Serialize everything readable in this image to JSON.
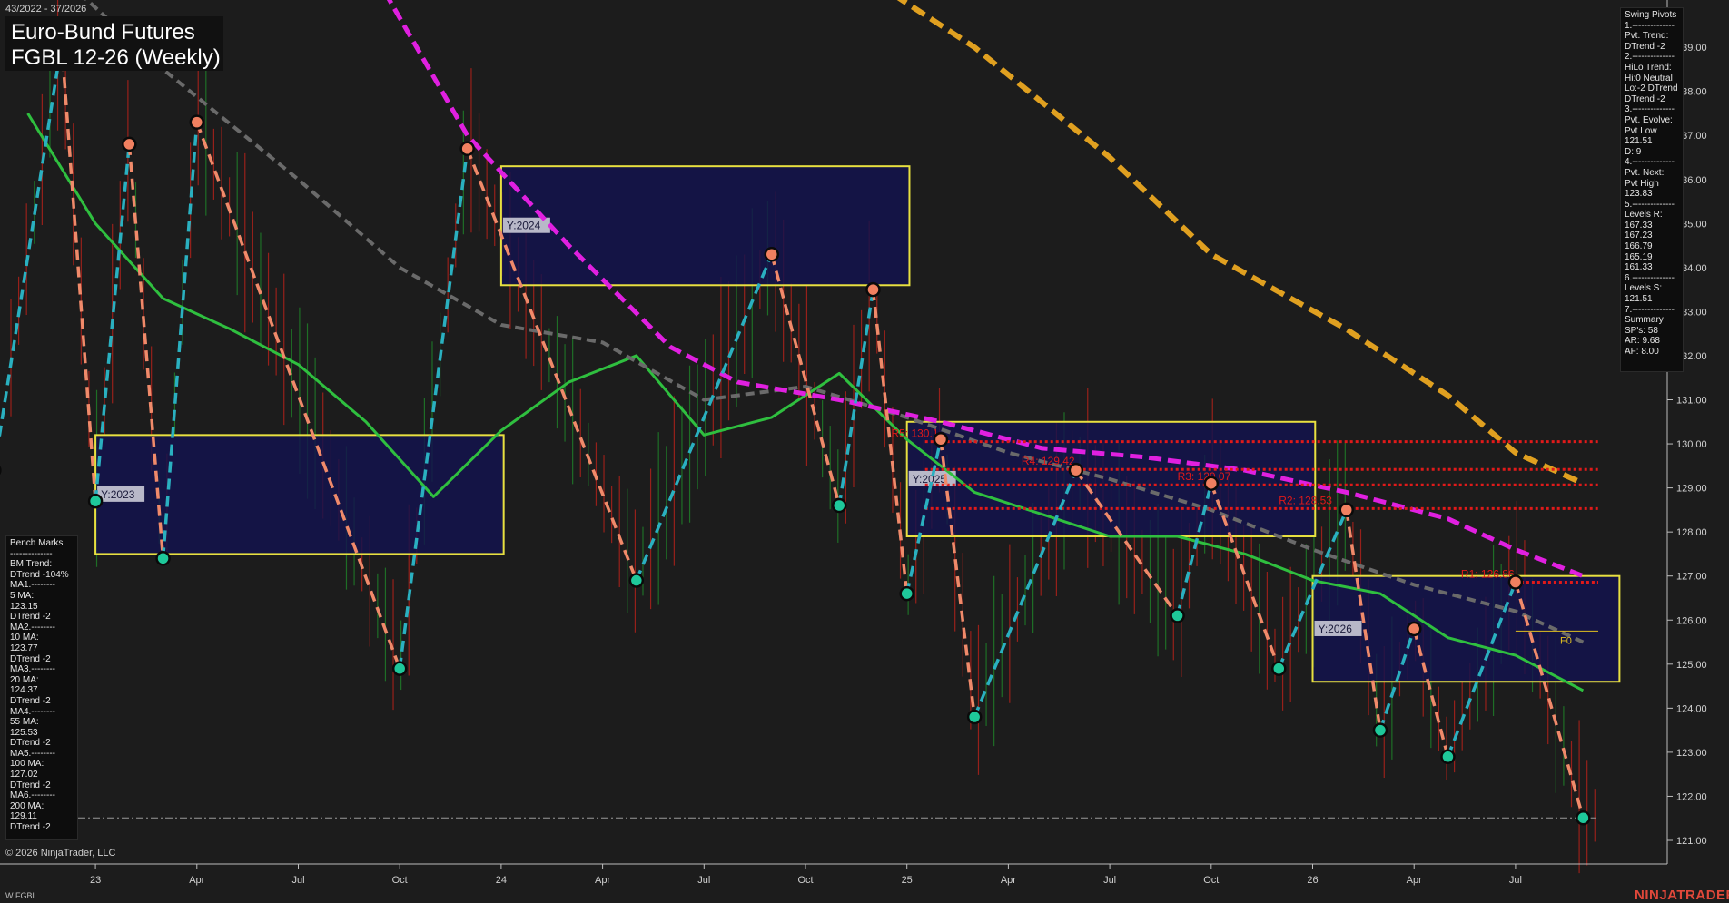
{
  "header": {
    "range": "43/2022 - 37/2026",
    "title_line1": "Euro-Bund Futures",
    "title_line2": "FGBL 12-26 (Weekly)"
  },
  "footer": {
    "copyright": "© 2026 NinjaTrader, LLC",
    "instrument": "W FGBL",
    "brand": "NINJATRADER"
  },
  "swing_panel": [
    "Swing Pivots",
    "1.--------------",
    "Pvt. Trend:",
    "DTrend -2",
    "2.--------------",
    "HiLo Trend:",
    "Hi:0 Neutral",
    "Lo:-2 DTrend",
    "DTrend -2",
    "3.--------------",
    "Pvt. Evolve:",
    "Pvt Low",
    "121.51",
    "D: 9",
    "4.--------------",
    "Pvt. Next:",
    "Pvt High",
    "123.83",
    "5.--------------",
    "Levels R:",
    "167.33",
    "167.23",
    "166.79",
    "165.19",
    "161.33",
    "6.--------------",
    "Levels S:",
    "121.51",
    "7.--------------",
    "Summary",
    "SP's: 58",
    "AR: 9.68",
    "AF: 8.00"
  ],
  "bench_panel": [
    "Bench Marks",
    "--------------",
    "BM Trend:",
    "DTrend -104%",
    "MA1.--------",
    "5 MA:",
    "123.15",
    "DTrend -2",
    "MA2.--------",
    "10 MA:",
    "123.77",
    "DTrend -2",
    "MA3.--------",
    "20 MA:",
    "124.37",
    "DTrend -2",
    "MA4.--------",
    "55 MA:",
    "125.53",
    "DTrend -2",
    "MA5.--------",
    "100 MA:",
    "127.02",
    "DTrend -2",
    "MA6.--------",
    "200 MA:",
    "129.11",
    "DTrend -2"
  ],
  "chart_data": {
    "type": "line",
    "title": "FGBL 12-26 (Weekly)",
    "xlabel": "",
    "ylabel": "",
    "ylim": [
      120.4,
      140.3
    ],
    "y_ticks": [
      "121.00",
      "122.00",
      "123.00",
      "124.00",
      "125.00",
      "126.00",
      "127.00",
      "128.00",
      "129.00",
      "130.00",
      "131.00",
      "132.00",
      "133.00",
      "134.00",
      "135.00",
      "136.00",
      "137.00",
      "138.00",
      "139.00"
    ],
    "x_ticks": [
      "23",
      "Apr",
      "Jul",
      "Oct",
      "24",
      "Apr",
      "Jul",
      "Oct",
      "25",
      "Apr",
      "Jul",
      "Oct",
      "26",
      "Apr",
      "Jul"
    ],
    "grid": false,
    "colors": {
      "background": "#1c1c1c",
      "ma_green": "#2fbf3f",
      "ma_gray": "#6a6a6a",
      "ma_magenta": "#e020e0",
      "ma_orange": "#e0a020",
      "pivot_up": "#2ab0c0",
      "pivot_down": "#f08a6a",
      "pivot_low_marker": "#1ec89a",
      "pivot_high_marker": "#f08060",
      "resistance": "#e01a1a",
      "year_box_fill": "#12124e",
      "year_box_border": "#e8e040",
      "bars_down": "#c0221a",
      "bars_up": "#1f8a2a"
    },
    "swing_pivots": [
      {
        "date": "2022-10",
        "price": 129.4,
        "type": "low"
      },
      {
        "date": "2022-12",
        "price": 139.1,
        "type": "high"
      },
      {
        "date": "2023-01",
        "price": 128.7,
        "type": "low"
      },
      {
        "date": "2023-02",
        "price": 136.8,
        "type": "high"
      },
      {
        "date": "2023-03",
        "price": 127.4,
        "type": "low"
      },
      {
        "date": "2023-04",
        "price": 137.3,
        "type": "high"
      },
      {
        "date": "2023-10",
        "price": 124.9,
        "type": "low"
      },
      {
        "date": "2023-12",
        "price": 136.7,
        "type": "high"
      },
      {
        "date": "2024-05",
        "price": 126.9,
        "type": "low"
      },
      {
        "date": "2024-09",
        "price": 134.3,
        "type": "high"
      },
      {
        "date": "2024-11",
        "price": 128.6,
        "type": "low"
      },
      {
        "date": "2024-12",
        "price": 133.5,
        "type": "high"
      },
      {
        "date": "2025-01",
        "price": 126.6,
        "type": "low"
      },
      {
        "date": "2025-02",
        "price": 130.1,
        "type": "high"
      },
      {
        "date": "2025-03",
        "price": 123.8,
        "type": "low"
      },
      {
        "date": "2025-06",
        "price": 129.4,
        "type": "high"
      },
      {
        "date": "2025-09",
        "price": 126.1,
        "type": "low"
      },
      {
        "date": "2025-10",
        "price": 129.1,
        "type": "high"
      },
      {
        "date": "2025-12",
        "price": 124.9,
        "type": "low"
      },
      {
        "date": "2026-02",
        "price": 128.5,
        "type": "high"
      },
      {
        "date": "2026-03",
        "price": 123.5,
        "type": "low"
      },
      {
        "date": "2026-04",
        "price": 125.8,
        "type": "high"
      },
      {
        "date": "2026-05",
        "price": 122.9,
        "type": "low"
      },
      {
        "date": "2026-07",
        "price": 126.86,
        "type": "high"
      },
      {
        "date": "2026-09",
        "price": 121.51,
        "type": "low"
      }
    ],
    "year_boxes": [
      {
        "label": "Y:2023",
        "from": "2023-01",
        "to": "2023-12",
        "high": 130.2,
        "low": 127.5
      },
      {
        "label": "Y:2024",
        "from": "2024-01",
        "to": "2024-12",
        "high": 136.3,
        "low": 133.6
      },
      {
        "label": "Y:2025",
        "from": "2025-01",
        "to": "2025-12",
        "high": 130.5,
        "low": 127.9
      },
      {
        "label": "Y:2026",
        "from": "2026-01",
        "to": "2026-09",
        "high": 127.0,
        "low": 124.6
      }
    ],
    "resistance_levels": [
      {
        "label": "R5: 130.1",
        "price": 130.05
      },
      {
        "label": "R4: 129.42",
        "price": 129.42
      },
      {
        "label": "R3: 129.07",
        "price": 129.07
      },
      {
        "label": "R2: 128.53",
        "price": 128.53
      },
      {
        "label": "R1: 126.86",
        "price": 126.86
      }
    ],
    "f0_label": "F0",
    "f0_price": 125.75,
    "support_line": 121.51,
    "moving_averages": [
      {
        "name": "MA green",
        "points": [
          [
            "2022-11",
            137.5
          ],
          [
            "2023-01",
            135.0
          ],
          [
            "2023-03",
            133.3
          ],
          [
            "2023-05",
            132.6
          ],
          [
            "2023-07",
            131.8
          ],
          [
            "2023-09",
            130.5
          ],
          [
            "2023-11",
            128.8
          ],
          [
            "2024-01",
            130.3
          ],
          [
            "2024-03",
            131.4
          ],
          [
            "2024-05",
            132.0
          ],
          [
            "2024-07",
            130.2
          ],
          [
            "2024-09",
            130.6
          ],
          [
            "2024-11",
            131.6
          ],
          [
            "2025-01",
            130.1
          ],
          [
            "2025-03",
            128.9
          ],
          [
            "2025-05",
            128.4
          ],
          [
            "2025-07",
            127.9
          ],
          [
            "2025-09",
            127.9
          ],
          [
            "2025-11",
            127.5
          ],
          [
            "2026-01",
            126.9
          ],
          [
            "2026-03",
            126.6
          ],
          [
            "2026-05",
            125.6
          ],
          [
            "2026-07",
            125.2
          ],
          [
            "2026-09",
            124.4
          ]
        ]
      },
      {
        "name": "MA gray",
        "points": [
          [
            "2022-10",
            142.0
          ],
          [
            "2023-03",
            138.5
          ],
          [
            "2023-07",
            136.0
          ],
          [
            "2023-10",
            134.0
          ],
          [
            "2024-01",
            132.7
          ],
          [
            "2024-04",
            132.3
          ],
          [
            "2024-07",
            131.0
          ],
          [
            "2024-10",
            131.3
          ],
          [
            "2025-01",
            130.6
          ],
          [
            "2025-04",
            129.8
          ],
          [
            "2025-07",
            129.2
          ],
          [
            "2025-10",
            128.5
          ],
          [
            "2026-01",
            127.6
          ],
          [
            "2026-04",
            126.8
          ],
          [
            "2026-07",
            126.2
          ],
          [
            "2026-09",
            125.5
          ]
        ]
      },
      {
        "name": "MA magenta",
        "points": [
          [
            "2023-09",
            141.0
          ],
          [
            "2023-12",
            137.0
          ],
          [
            "2024-03",
            134.5
          ],
          [
            "2024-06",
            132.2
          ],
          [
            "2024-08",
            131.4
          ],
          [
            "2024-11",
            131.0
          ],
          [
            "2025-02",
            130.5
          ],
          [
            "2025-05",
            129.9
          ],
          [
            "2025-08",
            129.7
          ],
          [
            "2025-11",
            129.4
          ],
          [
            "2026-02",
            128.9
          ],
          [
            "2026-05",
            128.3
          ],
          [
            "2026-07",
            127.6
          ],
          [
            "2026-09",
            127.0
          ]
        ]
      },
      {
        "name": "MA orange",
        "points": [
          [
            "2024-11",
            141.0
          ],
          [
            "2025-03",
            139.0
          ],
          [
            "2025-07",
            136.5
          ],
          [
            "2025-10",
            134.3
          ],
          [
            "2026-02",
            132.6
          ],
          [
            "2026-05",
            131.1
          ],
          [
            "2026-07",
            129.8
          ],
          [
            "2026-09",
            129.1
          ]
        ]
      }
    ]
  }
}
